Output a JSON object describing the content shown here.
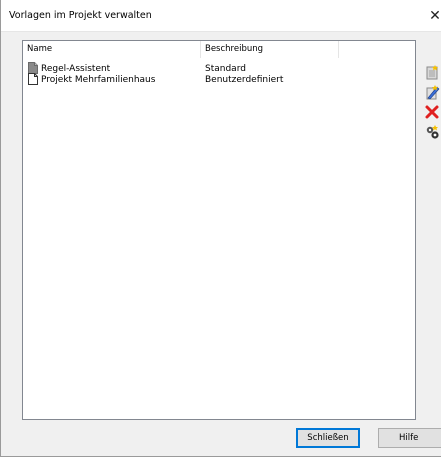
{
  "window": {
    "title": "Vorlagen im Projekt verwalten",
    "close_glyph": "✕"
  },
  "list": {
    "columns": [
      "Name",
      "Beschreibung"
    ],
    "rows": [
      {
        "name": "Regel-Assistent",
        "description": "Standard",
        "icon": "document-gray-icon"
      },
      {
        "name": "Projekt Mehrfamilienhaus",
        "description": "Benutzerdefiniert",
        "icon": "document-icon"
      }
    ]
  },
  "toolbar": {
    "tools": [
      "new-template-icon",
      "edit-template-icon",
      "delete-icon",
      "settings-icon"
    ]
  },
  "buttons": {
    "close_label": "Schließen",
    "help_label": "Hilfe"
  },
  "colors": {
    "delete": "#e02020",
    "accent": "#0078d7"
  }
}
